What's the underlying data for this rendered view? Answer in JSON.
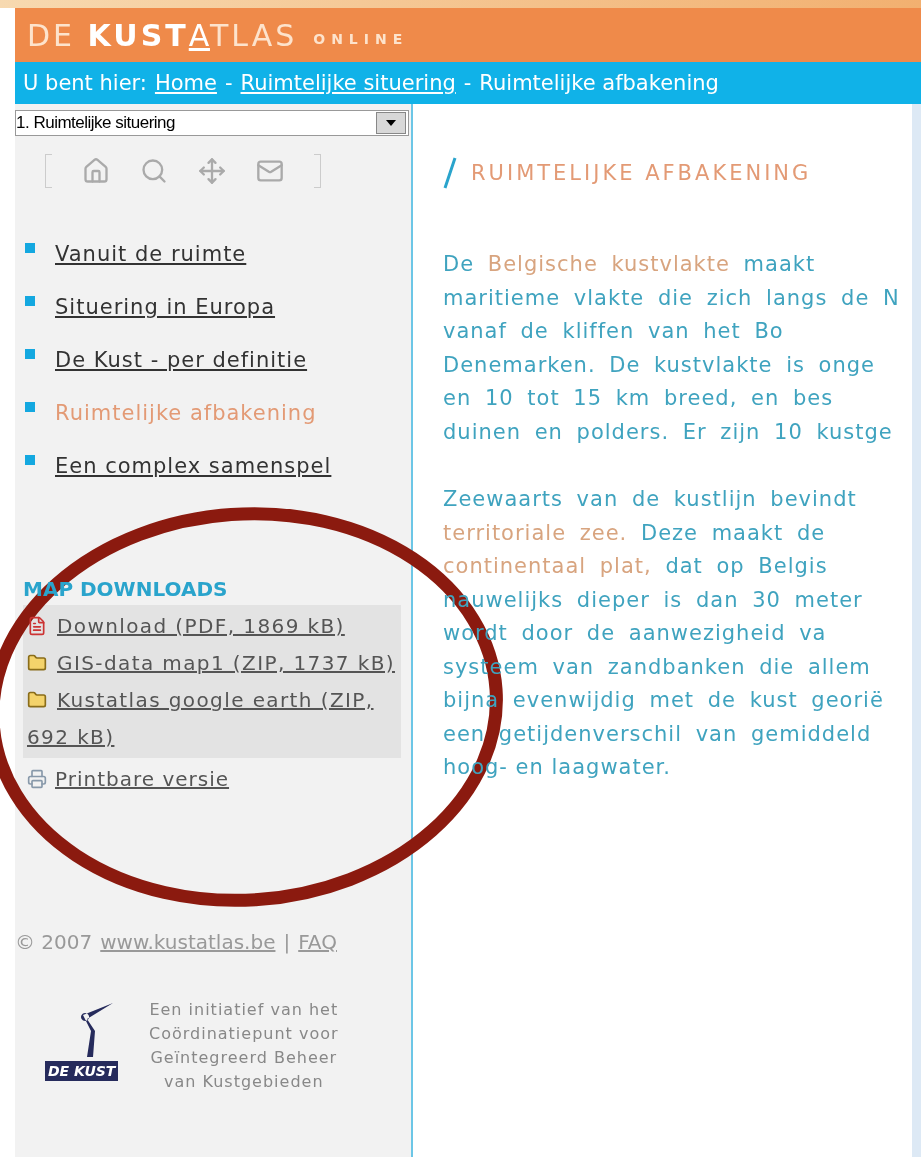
{
  "header": {
    "logo_parts": [
      {
        "text": "DE ",
        "kind": "light"
      },
      {
        "text": "KUST",
        "kind": "bold"
      },
      {
        "text": "A",
        "kind": "underlined"
      },
      {
        "text": "TLAS",
        "kind": "light"
      }
    ],
    "tagline": "ONLINE"
  },
  "breadcrumb": {
    "label": "U bent hier:",
    "separator": "-",
    "items": [
      {
        "text": "Home",
        "current": false
      },
      {
        "text": "Ruimtelijke situering",
        "current": false
      },
      {
        "text": "Ruimtelijke afbakening",
        "current": true
      }
    ]
  },
  "chapter_select": {
    "value": "1. Ruimtelijke situering"
  },
  "nav": [
    {
      "label": "Vanuit de ruimte",
      "selected": false
    },
    {
      "label": "Situering in Europa",
      "selected": false
    },
    {
      "label": "De Kust - per definitie",
      "selected": false
    },
    {
      "label": "Ruimtelijke afbakening",
      "selected": true
    },
    {
      "label": "Een complex samenspel",
      "selected": false
    }
  ],
  "map_downloads": {
    "title": "MAP DOWNLOADS",
    "files": [
      {
        "label": "Download (PDF, 1869 kB)",
        "kind": "pdf"
      },
      {
        "label": "GIS-data map1 (ZIP, 1737 kB)",
        "kind": "zip"
      },
      {
        "label": "Kustatlas google earth (ZIP, 692 kB)",
        "kind": "zip"
      }
    ],
    "print_link": "Printbare versie"
  },
  "footer": {
    "copyright": "© 2007",
    "site_link": "www.kustatlas.be",
    "separator": "|",
    "faq_link": "FAQ"
  },
  "partner": {
    "logo_text": "DE KUST",
    "caption": "Een initiatief van het\nCoördinatiepunt voor\nGeïntegreerd Beheer\nvan Kustgebieden"
  },
  "article": {
    "title": "RUIMTELIJKE AFBAKENING",
    "paragraphs": [
      [
        [
          {
            "text": "De "
          },
          {
            "text": "Belgische kustvlakte",
            "term": true
          },
          {
            "text": " maakt"
          }
        ],
        [
          {
            "text": "maritieme vlakte die zich langs de N"
          }
        ],
        [
          {
            "text": "vanaf de kliffen van het Bo"
          }
        ],
        [
          {
            "text": "Denemarken. De kustvlakte is onge"
          }
        ],
        [
          {
            "text": "en 10 tot 15 km breed, en bes"
          }
        ],
        [
          {
            "text": "duinen en polders. Er zijn 10 kustge"
          }
        ]
      ],
      [
        [
          {
            "text": "Zeewaarts van de kustlijn bevindt"
          }
        ],
        [
          {
            "text": "territoriale zee.",
            "term": true
          },
          {
            "text": " Deze maakt de"
          }
        ],
        [
          {
            "text": "continentaal plat,",
            "term": true
          },
          {
            "text": " dat op Belgis"
          }
        ],
        [
          {
            "text": "nauwelijks dieper is dan 30 meter"
          }
        ],
        [
          {
            "text": "wordt door de aanwezigheid va"
          }
        ],
        [
          {
            "text": "systeem van zandbanken die allem"
          }
        ],
        [
          {
            "text": "bijna evenwijdig met de kust georië"
          }
        ],
        [
          {
            "text": "een getijdenverschil van gemiddeld"
          }
        ],
        [
          {
            "text": "hoog- en laagwater."
          }
        ]
      ]
    ]
  }
}
